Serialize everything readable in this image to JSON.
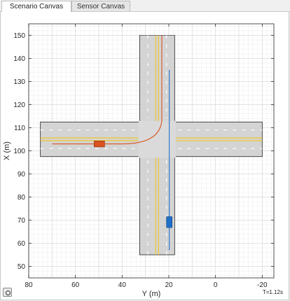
{
  "tabs": [
    {
      "label": "Scenario Canvas",
      "active": true
    },
    {
      "label": "Sensor Canvas",
      "active": false
    }
  ],
  "plot": {
    "xlabel": "Y (m)",
    "ylabel": "X (m)",
    "x_ticks": [
      "80",
      "60",
      "40",
      "20",
      "0",
      "-20"
    ],
    "y_ticks": [
      "150",
      "140",
      "130",
      "120",
      "110",
      "100",
      "90",
      "80",
      "70",
      "60",
      "50"
    ],
    "y_axis_range": [
      80,
      -25
    ],
    "x_axis_range": [
      45,
      155
    ],
    "colors": {
      "road": "#d4d4d4",
      "lane_center": "#f2c41b",
      "ego_path": "#d9531e",
      "ego_vehicle": "#d9531e",
      "target_path": "#1e6fc8",
      "target_vehicle": "#1e6fc8"
    }
  },
  "status": {
    "time": "T=1.12s"
  },
  "corner_button": {
    "icon": "camera-icon"
  }
}
